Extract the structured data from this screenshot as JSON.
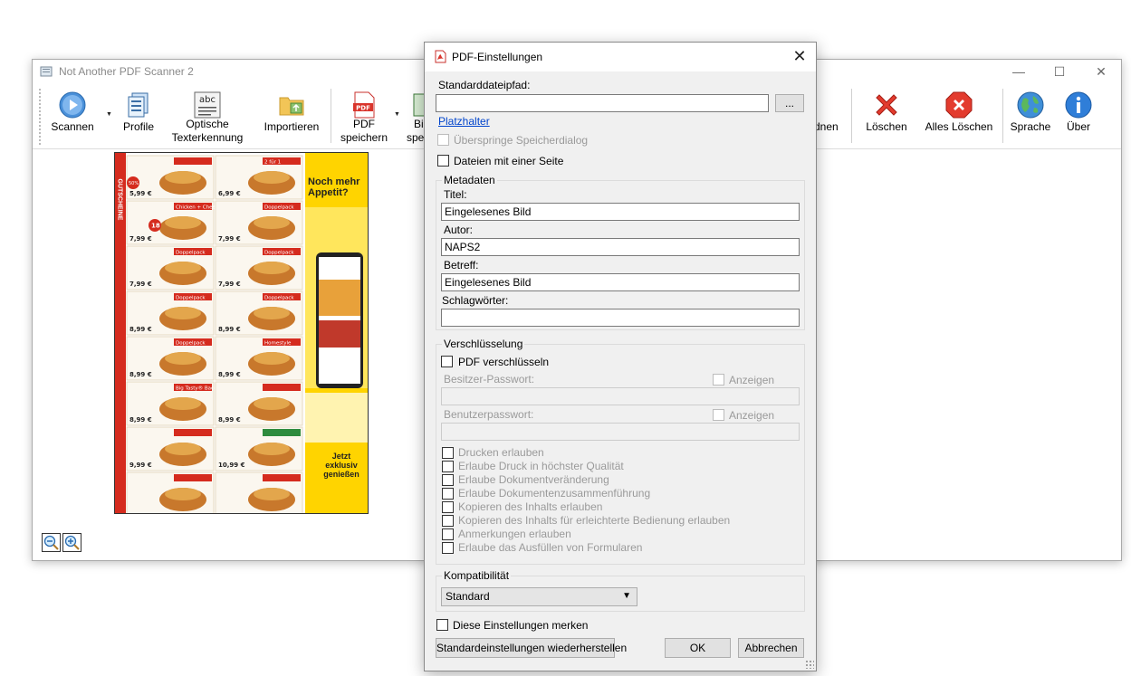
{
  "main_window": {
    "title": "Not Another PDF Scanner 2",
    "controls": {
      "minimize": "—",
      "maximize": "☐",
      "close": "✕"
    },
    "toolbar": {
      "scan": "Scannen",
      "profiles": "Profile",
      "ocr_line1": "Optische",
      "ocr_line2": "Texterkennung",
      "import": "Importieren",
      "save_pdf_line1": "PDF",
      "save_pdf_line2": "speichern",
      "save_image_line1": "Bi",
      "save_image_line2": "spei",
      "arrange_partial": "dnen",
      "delete": "Löschen",
      "delete_all": "Alles Löschen",
      "language": "Sprache",
      "about": "Über"
    },
    "zoom_out_icon": "zoom-out",
    "zoom_in_icon": "zoom-in"
  },
  "thumbnail": {
    "side_text": "GUTSCHEINE",
    "ad_heading": "Noch mehr Appetit?",
    "ad_footer": "Jetzt exklusiv genießen",
    "coupon_labels": [
      "2 für 1",
      "Chicken + Cheese Box",
      "Doppelpack",
      "Doppelpack",
      "Doppelpack",
      "Doppelpack",
      "Doppelpack",
      "Doppelpack",
      "Homestyle",
      "Big Tasty® Bacon"
    ],
    "prices": [
      "5,99 €",
      "6,99 €",
      "7,99 €",
      "7,99 €",
      "7,99 €",
      "7,99 €",
      "8,99 €",
      "8,99 €",
      "8,99 €",
      "8,99 €",
      "8,99 €",
      "8,99 €",
      "9,99 €",
      "10,99 €"
    ],
    "badges": [
      "50%",
      "18"
    ]
  },
  "dialog": {
    "title": "PDF-Einstellungen",
    "default_path_label": "Standarddateipfad:",
    "default_path_value": "",
    "browse_button": "...",
    "placeholder_link": "Platzhalter",
    "skip_save_dialog": "Überspringe Speicherdialog",
    "single_page_files": "Dateien mit einer Seite",
    "metadata": {
      "group_title": "Metadaten",
      "title_label": "Titel:",
      "title_value": "Eingelesenes Bild",
      "author_label": "Autor:",
      "author_value": "NAPS2",
      "subject_label": "Betreff:",
      "subject_value": "Eingelesenes Bild",
      "keywords_label": "Schlagwörter:",
      "keywords_value": ""
    },
    "encryption": {
      "group_title": "Verschlüsselung",
      "encrypt_pdf": "PDF verschlüsseln",
      "owner_password_label": "Besitzer-Passwort:",
      "show_owner": "Anzeigen",
      "user_password_label": "Benutzerpasswort:",
      "show_user": "Anzeigen",
      "permissions": [
        "Drucken erlauben",
        "Erlaube Druck in höchster Qualität",
        "Erlaube Dokumentveränderung",
        "Erlaube Dokumentenzusammenführung",
        "Kopieren des Inhalts erlauben",
        "Kopieren des Inhalts für erleichterte Bedienung erlauben",
        "Anmerkungen erlauben",
        "Erlaube das Ausfüllen von Formularen"
      ]
    },
    "compatibility": {
      "group_title": "Kompatibilität",
      "selected": "Standard"
    },
    "remember_settings": "Diese Einstellungen merken",
    "restore_defaults": "Standardeinstellungen wiederherstellen",
    "ok": "OK",
    "cancel": "Abbrechen"
  }
}
